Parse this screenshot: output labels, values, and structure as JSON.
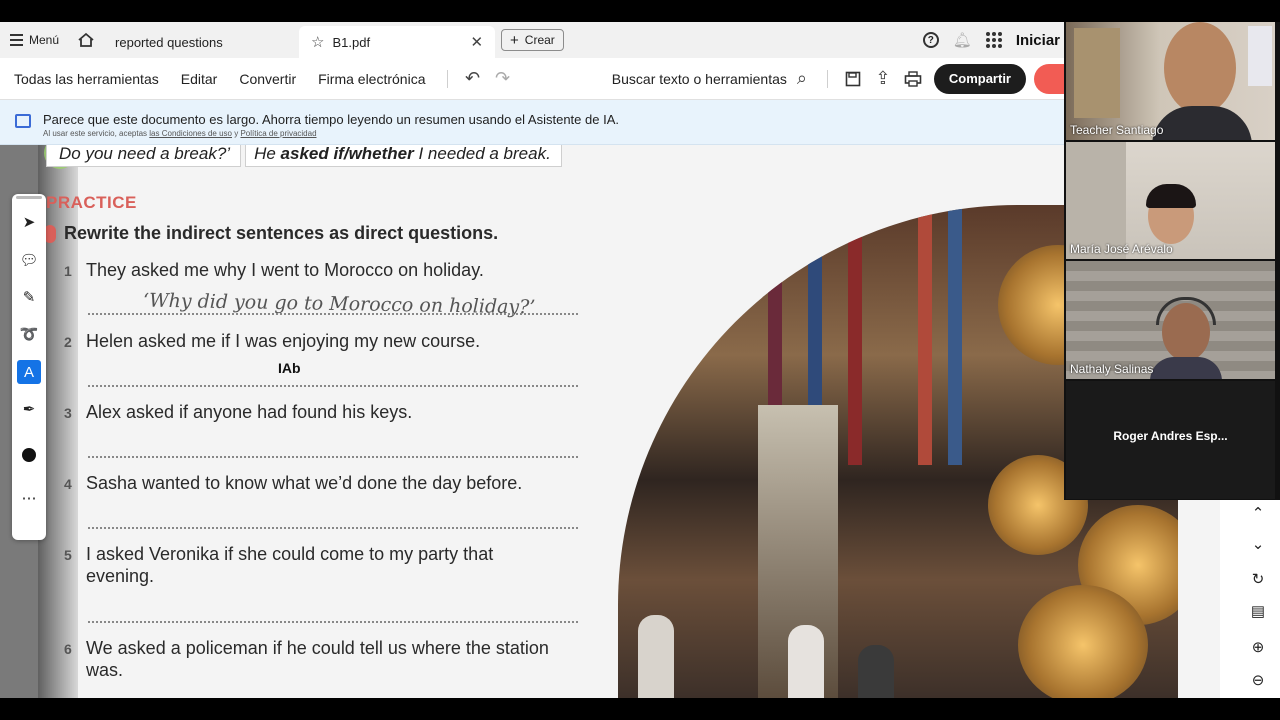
{
  "tabbar": {
    "menu_label": "Menú",
    "tabs": [
      {
        "label": "reported questions"
      },
      {
        "label": "B1.pdf"
      }
    ],
    "create_label": "Crear",
    "signin_label": "Iniciar"
  },
  "toolbar": {
    "all_tools": "Todas las herramientas",
    "edit": "Editar",
    "convert": "Convertir",
    "esign": "Firma electrónica",
    "search_label": "Buscar texto o herramientas",
    "share": "Compartir"
  },
  "banner": {
    "message": "Parece que este documento es largo. Ahorra tiempo leyendo un resumen usando el Asistente de IA.",
    "legal_prefix": "Al usar este servicio, aceptas",
    "terms_link": "las Condiciones de uso",
    "legal_and": "y",
    "privacy_link": "Política de privacidad"
  },
  "document": {
    "example_question": "Do you need a break?’",
    "example_answer_pre": "He",
    "example_answer_bold": "asked if/whether",
    "example_answer_post": "I needed a break.",
    "section_title": "PRACTICE",
    "instruction": "Rewrite the indirect sentences as direct questions.",
    "answer_1": "‘Why did you go to Morocco on holiday?’",
    "items": [
      {
        "num": "1",
        "text": "They asked me why I went to Morocco on holiday."
      },
      {
        "num": "2",
        "text": "Helen asked me if I was enjoying my new course."
      },
      {
        "num": "3",
        "text": "Alex asked if anyone had found his keys."
      },
      {
        "num": "4",
        "text": "Sasha wanted to know what we’d done the day before."
      },
      {
        "num": "5",
        "text": "I asked Veronika if she could come to my party that evening."
      },
      {
        "num": "6",
        "text": "We asked a policeman if he could tell us where the station was."
      }
    ],
    "cursor_text": "IAb"
  },
  "participants": [
    {
      "name": "Teacher Santiago"
    },
    {
      "name": "María José Arévalo"
    },
    {
      "name": "Nathaly Salinas"
    },
    {
      "name": "Roger Andres Esp..."
    }
  ],
  "colors": {
    "accent_blue": "#1473e6",
    "practice_red": "#d9605a",
    "share_bg": "#1d1d1d"
  }
}
